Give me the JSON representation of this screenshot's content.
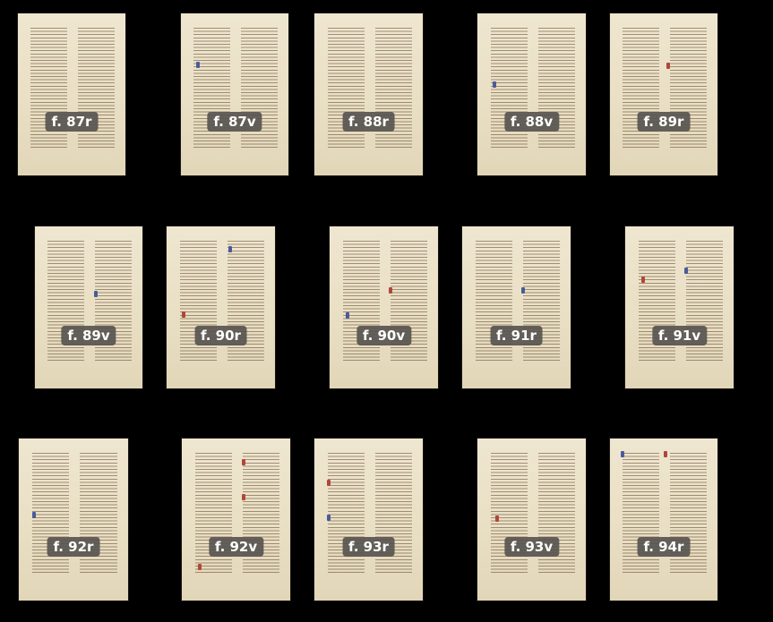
{
  "gallery": {
    "folios": [
      {
        "label": "f. 87r"
      },
      {
        "label": "f. 87v"
      },
      {
        "label": "f. 88r"
      },
      {
        "label": "f. 88v"
      },
      {
        "label": "f. 89r"
      },
      {
        "label": "f. 89v"
      },
      {
        "label": "f. 90r"
      },
      {
        "label": "f. 90v"
      },
      {
        "label": "f. 91r"
      },
      {
        "label": "f. 91v"
      },
      {
        "label": "f. 92r"
      },
      {
        "label": "f. 92v"
      },
      {
        "label": "f. 93r"
      },
      {
        "label": "f. 93v"
      },
      {
        "label": "f. 94r"
      }
    ]
  },
  "colors": {
    "background": "#000000",
    "parchment": "#efe6d0",
    "ink": "#60462c",
    "label_bg": "#585450",
    "label_text": "#ffffff",
    "initial_red": "#b0473a",
    "initial_blue": "#4a5a9a"
  }
}
